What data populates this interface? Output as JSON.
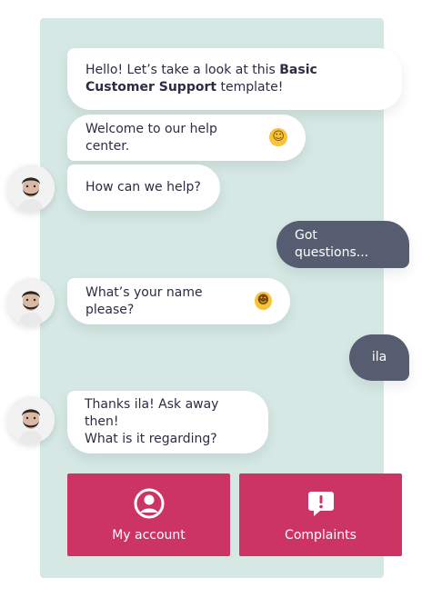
{
  "messages": [
    {
      "from": "bot",
      "parts": [
        "Hello! Let’s take a look at this ",
        "Basic Customer Support",
        " template!"
      ]
    },
    {
      "from": "bot",
      "text": "Welcome to our help center.",
      "emoji": "hugging-face-emoji"
    },
    {
      "from": "bot",
      "text": "How can we help?",
      "avatar": "bot-avatar"
    },
    {
      "from": "user",
      "text": "Got questions..."
    },
    {
      "from": "bot",
      "text": "What’s your name please?",
      "emoji": "grinning-face-emoji",
      "avatar": "bot-avatar"
    },
    {
      "from": "user",
      "text": "ila"
    },
    {
      "from": "bot",
      "lines": [
        "Thanks ila! Ask away then!",
        "What is it regarding?"
      ],
      "avatar": "bot-avatar"
    }
  ],
  "actions": [
    {
      "label": "My account",
      "icon": "user-circle-icon"
    },
    {
      "label": "Complaints",
      "icon": "alert-message-icon"
    }
  ],
  "colors": {
    "panel": "#d5e8e4",
    "user_bubble": "#575d70",
    "action": "#cc3464"
  }
}
